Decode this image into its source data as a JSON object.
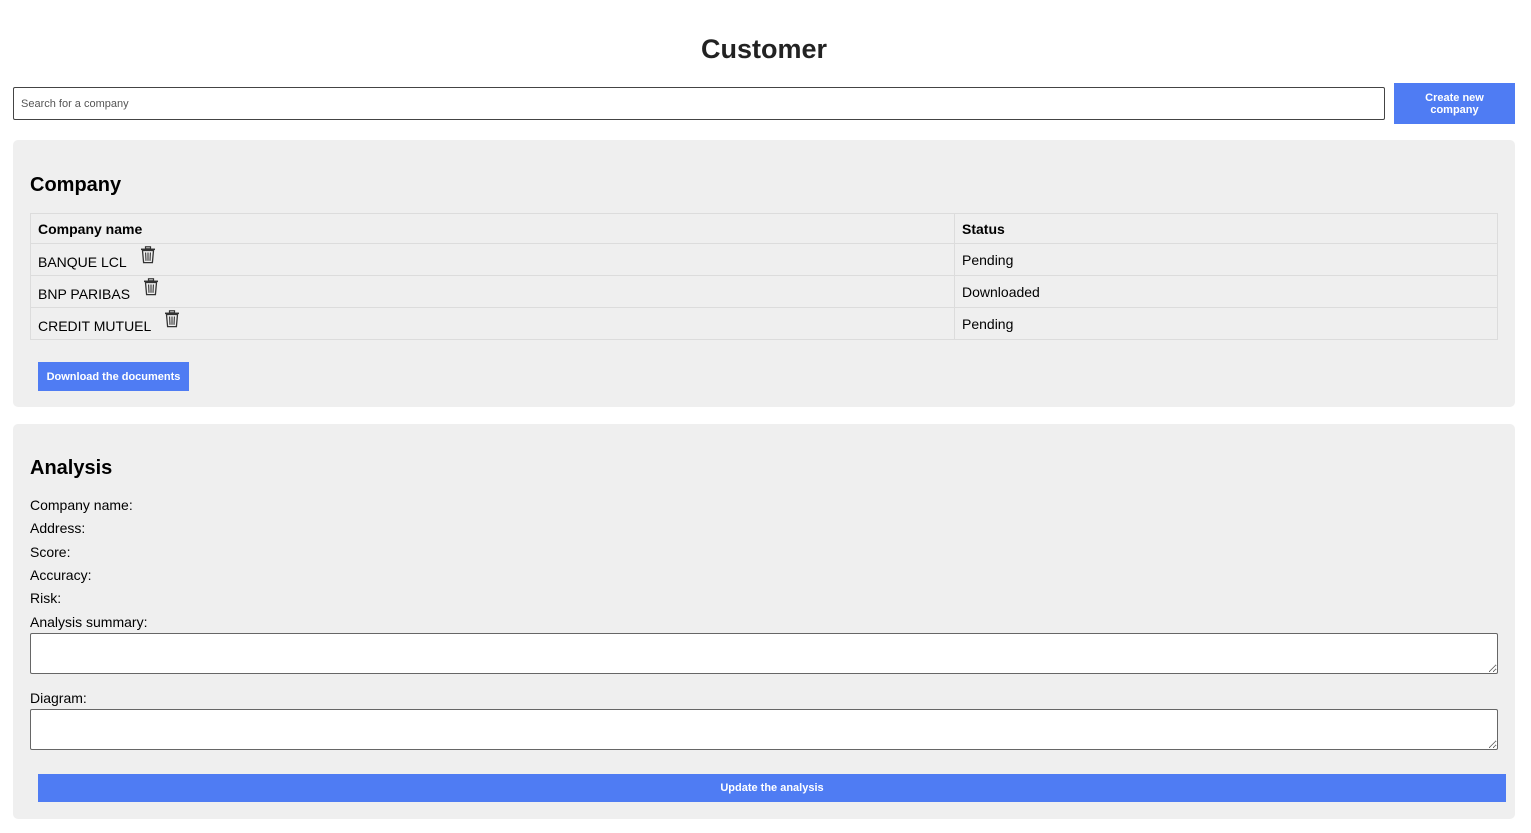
{
  "header": {
    "title": "Customer"
  },
  "search": {
    "placeholder": "Search for a company",
    "value": ""
  },
  "actions": {
    "create_label": "Create new company"
  },
  "company_section": {
    "title": "Company",
    "columns": [
      "Company name",
      "Status"
    ],
    "rows": [
      {
        "name": "BANQUE LCL",
        "status": "Pending",
        "delete_icon": "trash-icon"
      },
      {
        "name": "BNP PARIBAS",
        "status": "Downloaded",
        "delete_icon": "trash-icon"
      },
      {
        "name": "CREDIT MUTUEL",
        "status": "Pending",
        "delete_icon": "trash-icon"
      }
    ],
    "download_label": "Download the documents"
  },
  "analysis_section": {
    "title": "Analysis",
    "fields": [
      {
        "label": "Company name:",
        "value": ""
      },
      {
        "label": "Address:",
        "value": ""
      },
      {
        "label": "Score:",
        "value": ""
      },
      {
        "label": "Accuracy:",
        "value": ""
      },
      {
        "label": "Risk:",
        "value": ""
      }
    ],
    "summary_label": "Analysis summary:",
    "summary_value": "",
    "diagram_label": "Diagram:",
    "diagram_value": "",
    "update_label": "Update the analysis"
  },
  "colors": {
    "accent": "#4f7cf3",
    "panel_bg": "#efefef"
  }
}
